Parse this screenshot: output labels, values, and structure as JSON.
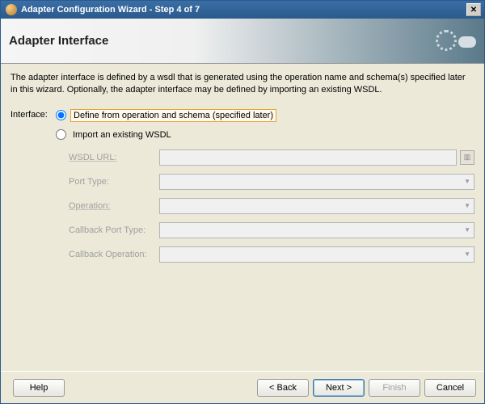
{
  "title": "Adapter Configuration Wizard - Step 4 of 7",
  "header": {
    "heading": "Adapter Interface"
  },
  "description": "The adapter interface is defined by a wsdl that is generated using the operation name and schema(s) specified later in this wizard.  Optionally, the adapter interface may be defined by importing an existing WSDL.",
  "interfaceLabel": "Interface:",
  "radios": {
    "define": "Define from operation and schema (specified later)",
    "import": "Import an existing WSDL"
  },
  "fields": {
    "wsdlUrl": {
      "label": "WSDL URL:",
      "value": ""
    },
    "portType": {
      "label": "Port Type:",
      "value": ""
    },
    "operation": {
      "label": "Operation:",
      "value": ""
    },
    "callbackPortType": {
      "label": "Callback Port Type:",
      "value": ""
    },
    "callbackOperation": {
      "label": "Callback Operation:",
      "value": ""
    }
  },
  "buttons": {
    "help": "Help",
    "back": "< Back",
    "next": "Next >",
    "finish": "Finish",
    "cancel": "Cancel"
  }
}
